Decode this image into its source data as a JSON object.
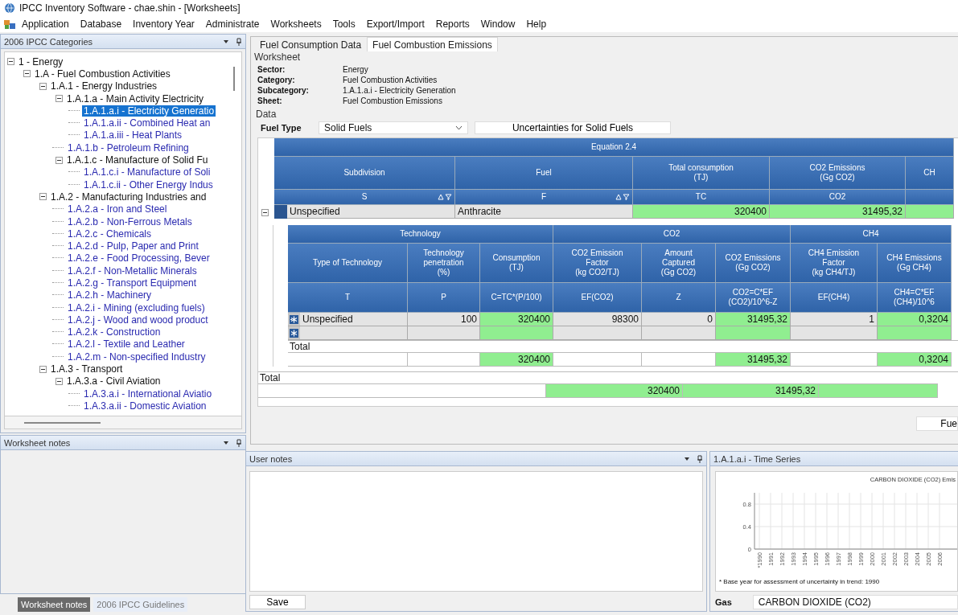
{
  "window": {
    "title": "IPCC Inventory Software - chae.shin - [Worksheets]"
  },
  "menu": [
    "Application",
    "Database",
    "Inventory Year",
    "Administrate",
    "Worksheets",
    "Tools",
    "Export/Import",
    "Reports",
    "Window",
    "Help"
  ],
  "categories_panel": {
    "title": "2006 IPCC Categories",
    "tree": [
      {
        "label": "1 - Energy",
        "selected": false,
        "expanded": true,
        "children": [
          {
            "label": "1.A - Fuel Combustion Activities",
            "selected": false,
            "expanded": true,
            "children": [
              {
                "label": "1.A.1 - Energy Industries",
                "selected": false,
                "expanded": true,
                "children": [
                  {
                    "label": "1.A.1.a - Main Activity Electricity",
                    "selected": false,
                    "expanded": true,
                    "children": [
                      {
                        "label": "1.A.1.a.i - Electricity Generatio",
                        "selected": true
                      },
                      {
                        "label": "1.A.1.a.ii - Combined Heat an",
                        "selected": false
                      },
                      {
                        "label": "1.A.1.a.iii - Heat Plants",
                        "selected": false
                      }
                    ]
                  },
                  {
                    "label": "1.A.1.b - Petroleum Refining",
                    "selected": false
                  },
                  {
                    "label": "1.A.1.c - Manufacture of Solid Fu",
                    "selected": false,
                    "expanded": true,
                    "children": [
                      {
                        "label": "1.A.1.c.i - Manufacture of Soli",
                        "selected": false
                      },
                      {
                        "label": "1.A.1.c.ii - Other Energy Indus",
                        "selected": false
                      }
                    ]
                  }
                ]
              },
              {
                "label": "1.A.2 - Manufacturing Industries and",
                "selected": false,
                "expanded": true,
                "children": [
                  {
                    "label": "1.A.2.a - Iron and Steel",
                    "selected": false
                  },
                  {
                    "label": "1.A.2.b - Non-Ferrous Metals",
                    "selected": false
                  },
                  {
                    "label": "1.A.2.c - Chemicals",
                    "selected": false
                  },
                  {
                    "label": "1.A.2.d - Pulp, Paper and Print",
                    "selected": false
                  },
                  {
                    "label": "1.A.2.e - Food Processing, Bever",
                    "selected": false
                  },
                  {
                    "label": "1.A.2.f - Non-Metallic Minerals",
                    "selected": false
                  },
                  {
                    "label": "1.A.2.g - Transport Equipment",
                    "selected": false
                  },
                  {
                    "label": "1.A.2.h - Machinery",
                    "selected": false
                  },
                  {
                    "label": "1.A.2.i - Mining (excluding fuels)",
                    "selected": false
                  },
                  {
                    "label": "1.A.2.j - Wood and wood product",
                    "selected": false
                  },
                  {
                    "label": "1.A.2.k - Construction",
                    "selected": false
                  },
                  {
                    "label": "1.A.2.l - Textile and Leather",
                    "selected": false
                  },
                  {
                    "label": "1.A.2.m - Non-specified Industry",
                    "selected": false
                  }
                ]
              },
              {
                "label": "1.A.3 - Transport",
                "selected": false,
                "expanded": true,
                "children": [
                  {
                    "label": "1.A.3.a - Civil Aviation",
                    "selected": false,
                    "expanded": true,
                    "children": [
                      {
                        "label": "1.A.3.a.i - International Aviatio",
                        "selected": false
                      },
                      {
                        "label": "1.A.3.a.ii - Domestic Aviation",
                        "selected": false
                      }
                    ]
                  }
                ]
              }
            ]
          }
        ]
      }
    ]
  },
  "worksheet_notes_panel": {
    "title": "Worksheet notes"
  },
  "left_tabs": [
    {
      "label": "Worksheet notes",
      "selected": true
    },
    {
      "label": "2006 IPCC Guidelines",
      "selected": false
    }
  ],
  "tabs": [
    {
      "label": "Fuel Consumption Data",
      "selected": false
    },
    {
      "label": "Fuel Combustion Emissions",
      "selected": true
    }
  ],
  "worksheet": {
    "heading": "Worksheet",
    "fields": [
      {
        "label": "Sector:",
        "value": "Energy"
      },
      {
        "label": "Category:",
        "value": "Fuel Combustion Activities"
      },
      {
        "label": "Subcategory:",
        "value": "1.A.1.a.i - Electricity Generation"
      },
      {
        "label": "Sheet:",
        "value": "Fuel Combustion Emissions"
      }
    ]
  },
  "data": {
    "heading": "Data",
    "fuel_type_label": "Fuel Type",
    "fuel_type": "Solid Fuels",
    "uncertainty_button": "Uncertainties for Solid Fuels",
    "grid": {
      "group": "Equation 2.4",
      "expanded": true,
      "columns": [
        {
          "title": "Subdivision",
          "code": "S",
          "sortable": true,
          "computed": false
        },
        {
          "title": "Fuel",
          "code": "F",
          "sortable": true,
          "computed": false
        },
        {
          "title": "Total consumption\n(TJ)",
          "code": "TC",
          "sortable": false,
          "computed": true,
          "total": "320400"
        },
        {
          "title": "CO2 Emissions\n(Gg CO2)",
          "code": "CO2",
          "sortable": false,
          "computed": true,
          "total": "31495,32"
        },
        {
          "title": "CH",
          "sortable": false,
          "computed": true
        }
      ],
      "rows": [
        {
          "cells": [
            "Unspecified",
            "Anthracite",
            "320400",
            "31495,32"
          ]
        }
      ],
      "total_label": "Total",
      "sub_grid": {
        "groups": [
          {
            "title": "Technology",
            "columns": [
              {
                "title": "Type of Technology",
                "code": "T",
                "computed": false
              },
              {
                "title": "Technology\npenetration\n(%)",
                "code": "P",
                "computed": false
              },
              {
                "title": "Consumption\n(TJ)",
                "code": "C=TC*(P/100)",
                "computed": true,
                "total": "320400"
              }
            ]
          },
          {
            "title": "CO2",
            "columns": [
              {
                "title": "CO2 Emission\nFactor\n(kg CO2/TJ)",
                "code": "EF(CO2)",
                "computed": false
              },
              {
                "title": "Amount\nCaptured\n(Gg CO2)",
                "code": "Z",
                "computed": false
              },
              {
                "title": "CO2 Emissions\n(Gg CO2)",
                "code": "CO2=C*EF\n(CO2)/10^6-Z",
                "computed": true,
                "total": "31495,32"
              }
            ]
          },
          {
            "title": "CH4",
            "columns": [
              {
                "title": "CH4 Emission\nFactor\n(kg CH4/TJ)",
                "code": "EF(CH4)",
                "computed": false
              },
              {
                "title": "CH4 Emissions\n(Gg CH4)",
                "code": "CH4=C*EF\n(CH4)/10^6",
                "computed": true,
                "total": "0,3204"
              }
            ]
          }
        ],
        "rows": [
          {
            "kind": "data",
            "cells": [
              "Unspecified",
              "100",
              "320400",
              "98300",
              "0",
              "31495,32",
              "1",
              "0,3204"
            ]
          },
          {
            "kind": "new"
          }
        ],
        "total_label": "Total"
      }
    },
    "fuel_button": "Fue"
  },
  "user_notes": {
    "title": "User notes",
    "save_button": "Save"
  },
  "time_series": {
    "title": "1.A.1.a.i - Time Series",
    "chart_data": {
      "type": "line",
      "title": "CARBON DIOXIDE (CO2) Emis",
      "categories": [
        "*1990",
        "1991",
        "1992",
        "1993",
        "1994",
        "1995",
        "1996",
        "1997",
        "1998",
        "1999",
        "2000",
        "2001",
        "2002",
        "2003",
        "2004",
        "2005",
        "2006"
      ],
      "ylim": [
        0,
        1
      ],
      "yticks": [
        0,
        0.4,
        0.8
      ],
      "grid": true
    },
    "footnote": "* Base year for assessment of uncertainty in trend: 1990",
    "gas_label": "Gas",
    "gas": "CARBON DIOXIDE (CO2)"
  }
}
